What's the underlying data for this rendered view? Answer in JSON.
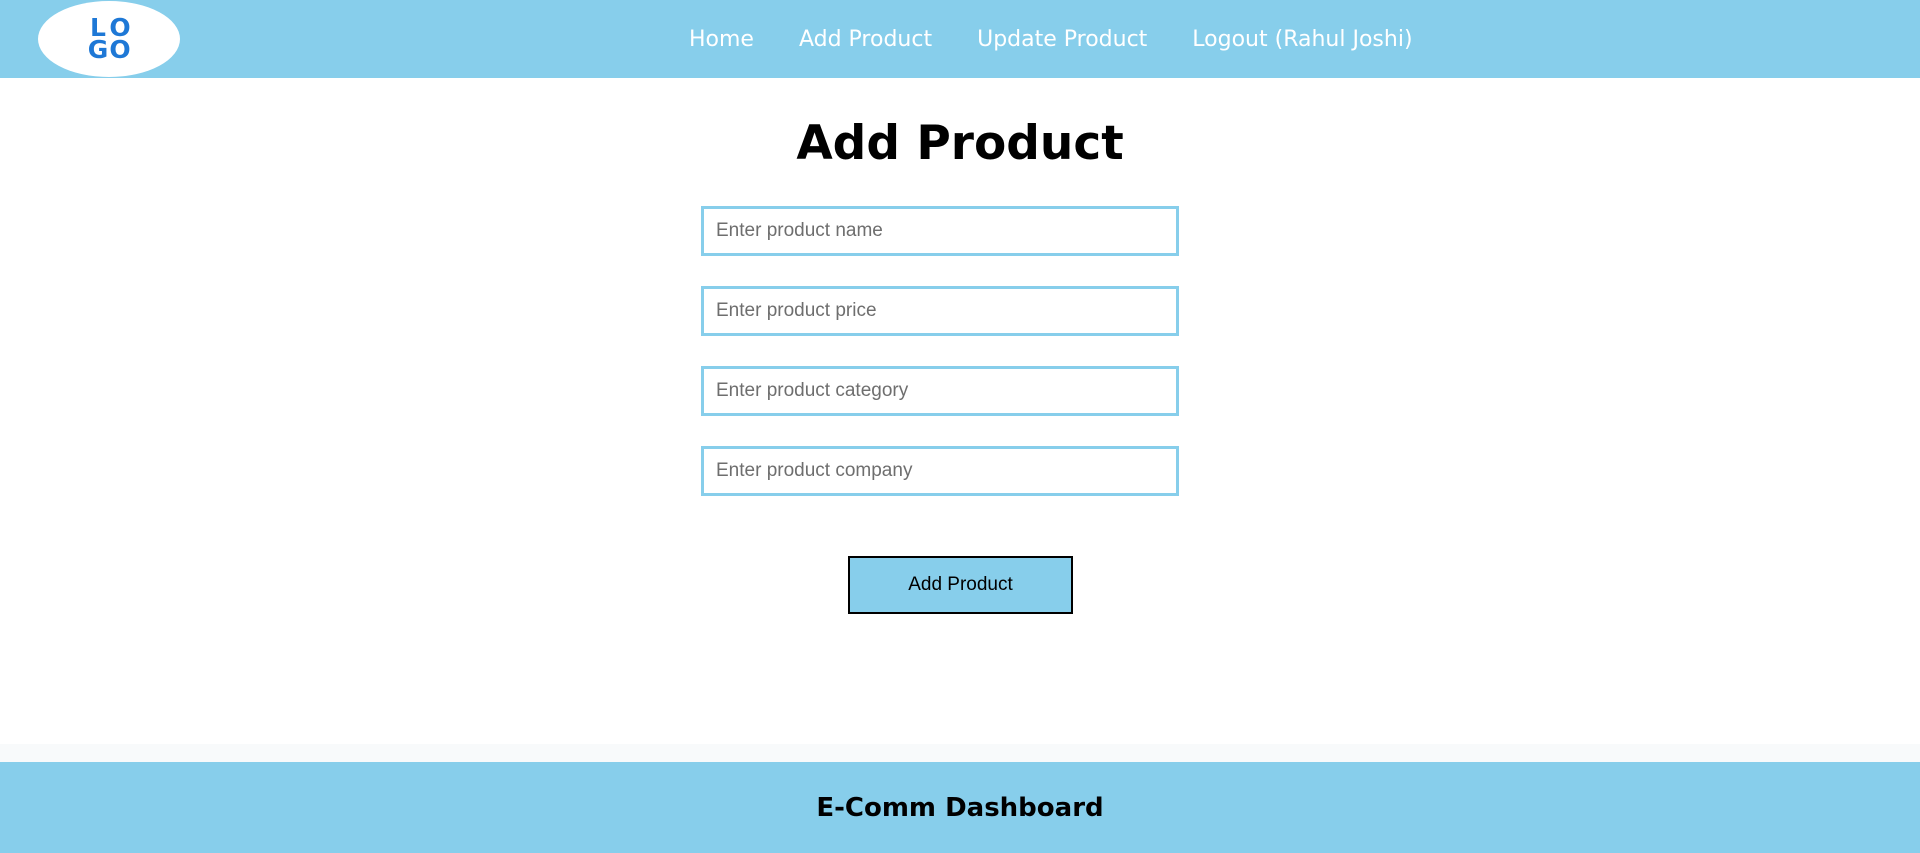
{
  "header": {
    "logo": {
      "letters": [
        "L",
        "O",
        "G",
        "O"
      ],
      "color": "#1e78d6"
    },
    "nav": [
      {
        "label": "Home"
      },
      {
        "label": "Add Product"
      },
      {
        "label": "Update Product"
      },
      {
        "label": "Logout (Rahul Joshi)"
      }
    ],
    "background": "#87ceeb"
  },
  "main": {
    "title": "Add Product",
    "fields": {
      "name": {
        "value": "",
        "placeholder": "Enter product name"
      },
      "price": {
        "value": "",
        "placeholder": "Enter product price"
      },
      "category": {
        "value": "",
        "placeholder": "Enter product category"
      },
      "company": {
        "value": "",
        "placeholder": "Enter product company"
      }
    },
    "submit_label": "Add Product"
  },
  "footer": {
    "title": "E-Comm Dashboard"
  }
}
